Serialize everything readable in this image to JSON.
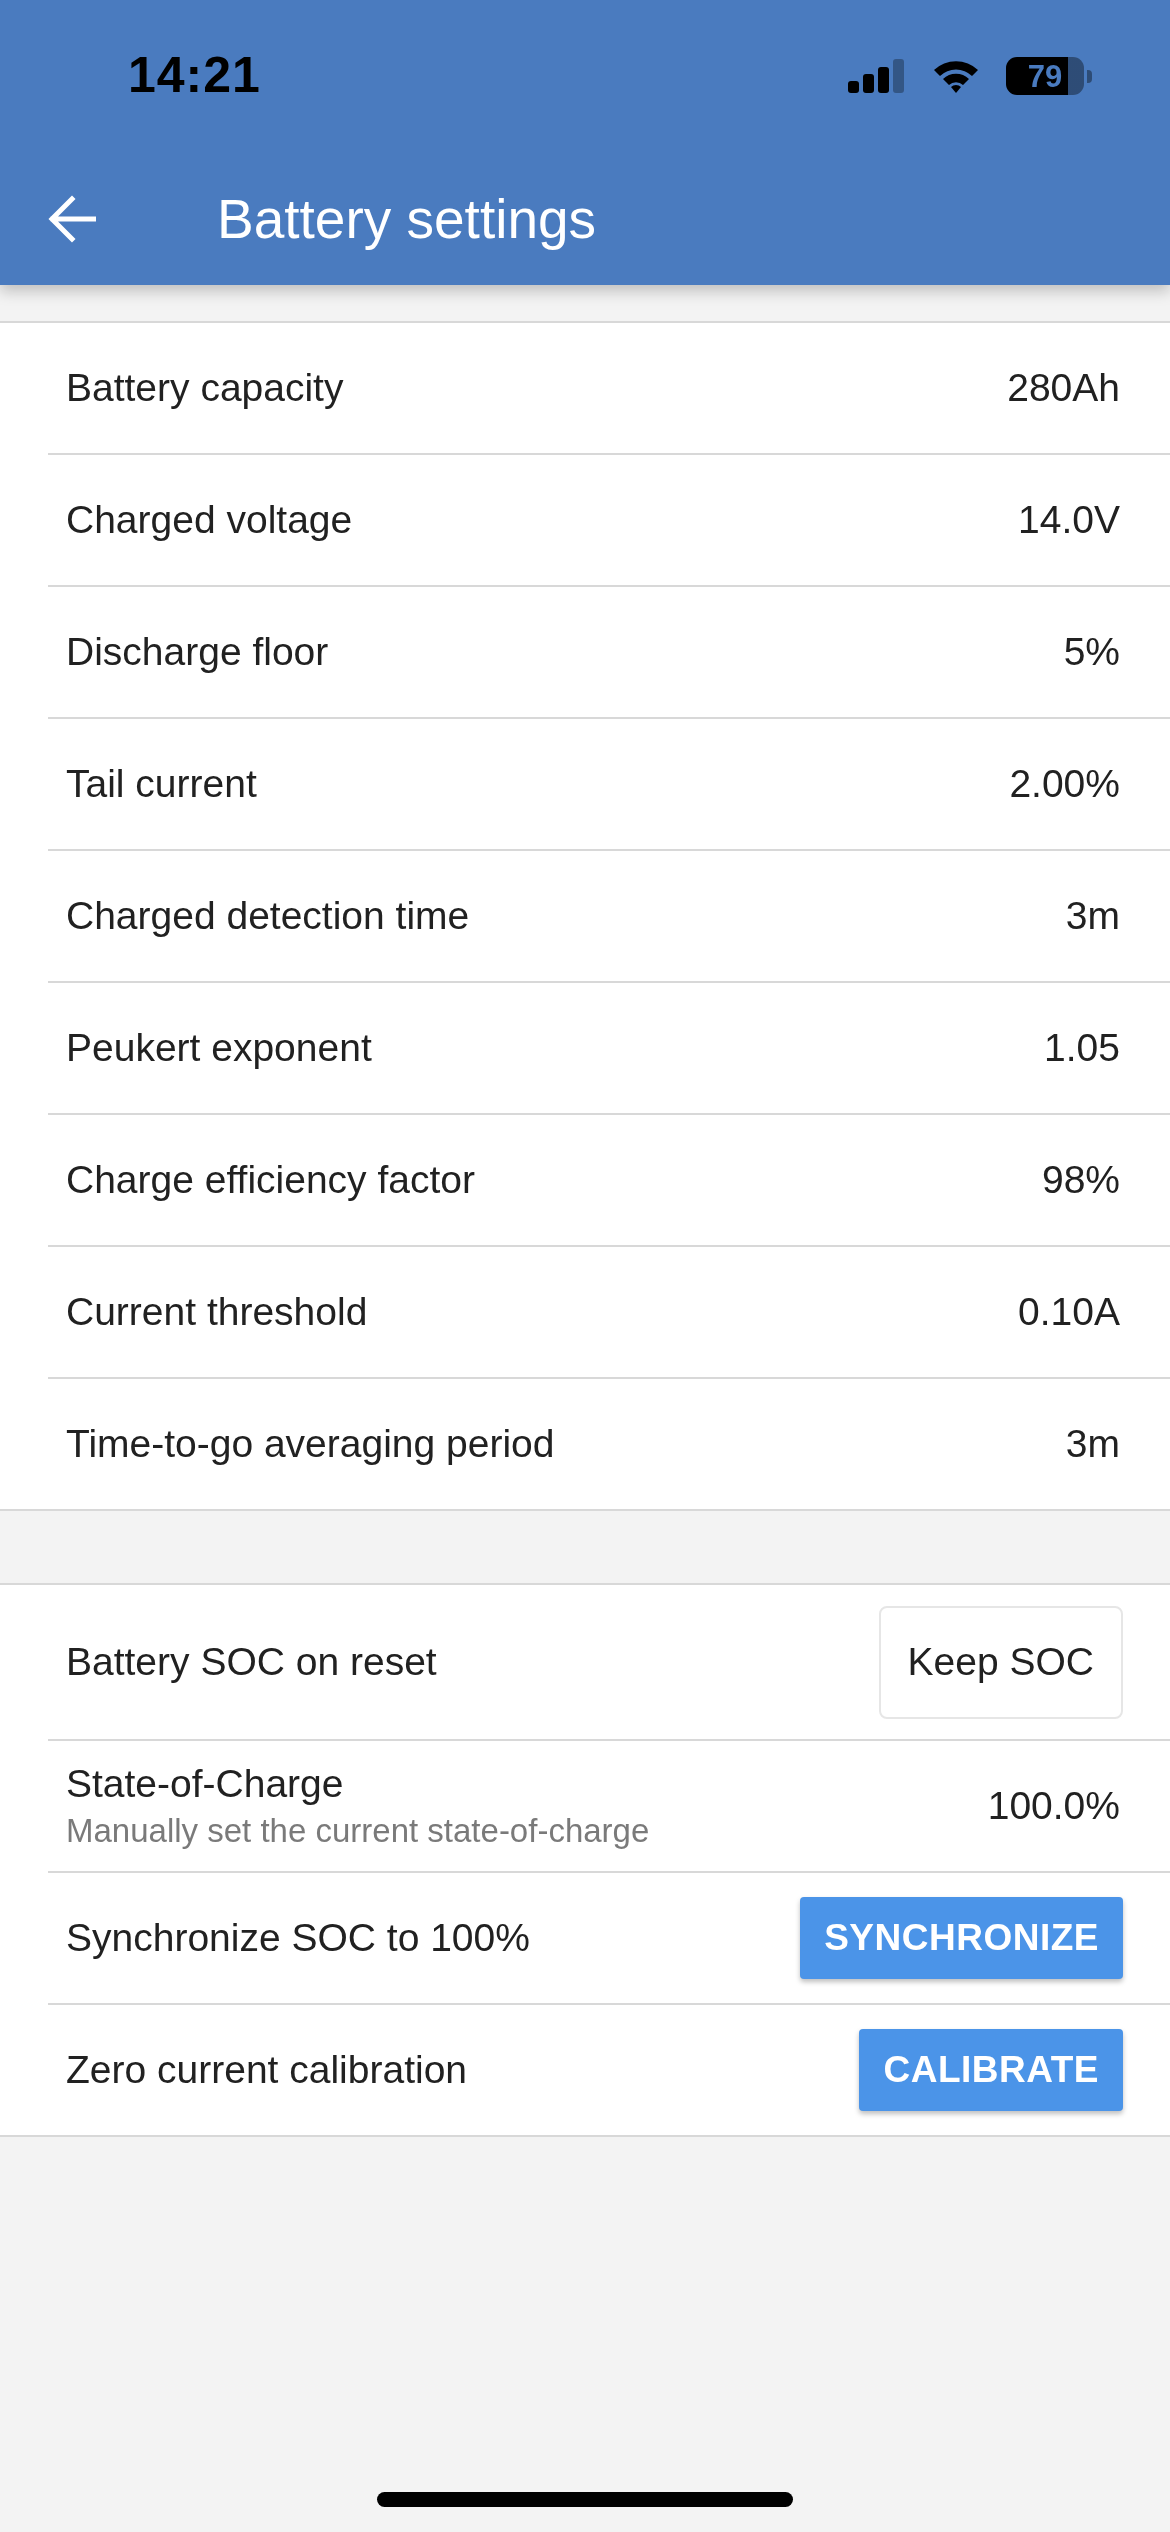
{
  "status_bar": {
    "time": "14:21",
    "battery": "79"
  },
  "app_bar": {
    "title": "Battery settings"
  },
  "sections": [
    {
      "rows": [
        {
          "kind": "value",
          "label": "Battery capacity",
          "value": "280Ah"
        },
        {
          "kind": "value",
          "label": "Charged voltage",
          "value": "14.0V"
        },
        {
          "kind": "value",
          "label": "Discharge floor",
          "value": "5%"
        },
        {
          "kind": "value",
          "label": "Tail current",
          "value": "2.00%"
        },
        {
          "kind": "value",
          "label": "Charged detection time",
          "value": "3m"
        },
        {
          "kind": "value",
          "label": "Peukert exponent",
          "value": "1.05"
        },
        {
          "kind": "value",
          "label": "Charge efficiency factor",
          "value": "98%"
        },
        {
          "kind": "value",
          "label": "Current threshold",
          "value": "0.10A"
        },
        {
          "kind": "value",
          "label": "Time-to-go averaging period",
          "value": "3m"
        }
      ]
    },
    {
      "rows": [
        {
          "kind": "select",
          "label": "Battery SOC on reset",
          "value": "Keep SOC"
        },
        {
          "kind": "value",
          "label": "State-of-Charge",
          "description": "Manually set the current state-of-charge",
          "value": "100.0%"
        },
        {
          "kind": "action",
          "label": "Synchronize SOC to 100%",
          "button": "SYNCHRONIZE"
        },
        {
          "kind": "action",
          "label": "Zero current calibration",
          "button": "CALIBRATE"
        }
      ]
    }
  ]
}
